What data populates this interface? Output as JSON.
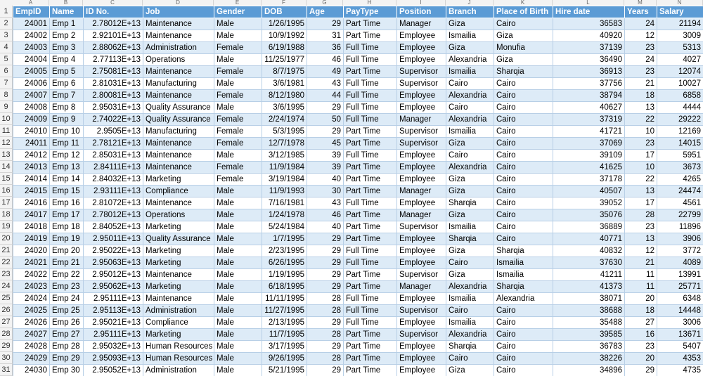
{
  "column_letters": [
    "A",
    "B",
    "C",
    "D",
    "E",
    "F",
    "G",
    "H",
    "I",
    "J",
    "K",
    "L",
    "M",
    "N"
  ],
  "row_numbers": [
    "1",
    "2",
    "3",
    "4",
    "5",
    "6",
    "7",
    "8",
    "9",
    "10",
    "11",
    "12",
    "13",
    "14",
    "15",
    "16",
    "17",
    "18",
    "19",
    "20",
    "21",
    "22",
    "23",
    "24",
    "25",
    "26",
    "27",
    "28",
    "29",
    "30",
    "31"
  ],
  "headers": [
    "EmpID",
    "Name",
    "ID No.",
    "Job",
    "Gender",
    "DOB",
    "Age",
    "PayType",
    "Position",
    "Branch",
    "Place of Birth",
    "Hire date",
    "Years",
    "Salary"
  ],
  "colors": {
    "header_bg": "#5b9bd5",
    "header_text": "#ffffff",
    "band_bg": "#ddebf7",
    "grid": "#b8cfe6"
  },
  "rows": [
    [
      "24001",
      "Emp 1",
      "2.78012E+13",
      "Maintenance",
      "Male",
      "1/26/1995",
      "29",
      "Part Time",
      "Manager",
      "Giza",
      "Cairo",
      "36583",
      "24",
      "21194"
    ],
    [
      "24002",
      "Emp 2",
      "2.92101E+13",
      "Maintenance",
      "Male",
      "10/9/1992",
      "31",
      "Part Time",
      "Employee",
      "Ismailia",
      "Giza",
      "40920",
      "12",
      "3009"
    ],
    [
      "24003",
      "Emp 3",
      "2.88062E+13",
      "Administration",
      "Female",
      "6/19/1988",
      "36",
      "Full Time",
      "Employee",
      "Giza",
      "Monufia",
      "37139",
      "23",
      "5313"
    ],
    [
      "24004",
      "Emp 4",
      "2.77113E+13",
      "Operations",
      "Male",
      "11/25/1977",
      "46",
      "Full Time",
      "Employee",
      "Alexandria",
      "Giza",
      "36490",
      "24",
      "4027"
    ],
    [
      "24005",
      "Emp 5",
      "2.75081E+13",
      "Maintenance",
      "Female",
      "8/7/1975",
      "49",
      "Part Time",
      "Supervisor",
      "Ismailia",
      "Sharqia",
      "36913",
      "23",
      "12074"
    ],
    [
      "24006",
      "Emp 6",
      "2.81031E+13",
      "Manufacturing",
      "Male",
      "3/6/1981",
      "43",
      "Full Time",
      "Supervisor",
      "Cairo",
      "Cairo",
      "37756",
      "21",
      "10027"
    ],
    [
      "24007",
      "Emp 7",
      "2.80081E+13",
      "Maintenance",
      "Female",
      "8/12/1980",
      "44",
      "Full Time",
      "Employee",
      "Alexandria",
      "Cairo",
      "38794",
      "18",
      "6858"
    ],
    [
      "24008",
      "Emp 8",
      "2.95031E+13",
      "Quality Assurance",
      "Male",
      "3/6/1995",
      "29",
      "Full Time",
      "Employee",
      "Cairo",
      "Cairo",
      "40627",
      "13",
      "4444"
    ],
    [
      "24009",
      "Emp 9",
      "2.74022E+13",
      "Quality Assurance",
      "Female",
      "2/24/1974",
      "50",
      "Full Time",
      "Manager",
      "Alexandria",
      "Cairo",
      "37319",
      "22",
      "29222"
    ],
    [
      "24010",
      "Emp 10",
      "2.9505E+13",
      "Manufacturing",
      "Female",
      "5/3/1995",
      "29",
      "Part Time",
      "Supervisor",
      "Ismailia",
      "Cairo",
      "41721",
      "10",
      "12169"
    ],
    [
      "24011",
      "Emp 11",
      "2.78121E+13",
      "Maintenance",
      "Female",
      "12/7/1978",
      "45",
      "Part Time",
      "Supervisor",
      "Giza",
      "Cairo",
      "37069",
      "23",
      "14015"
    ],
    [
      "24012",
      "Emp 12",
      "2.85031E+13",
      "Maintenance",
      "Male",
      "3/12/1985",
      "39",
      "Full Time",
      "Employee",
      "Cairo",
      "Cairo",
      "39109",
      "17",
      "5951"
    ],
    [
      "24013",
      "Emp 13",
      "2.84111E+13",
      "Maintenance",
      "Female",
      "11/9/1984",
      "39",
      "Part Time",
      "Employee",
      "Alexandria",
      "Cairo",
      "41625",
      "10",
      "3673"
    ],
    [
      "24014",
      "Emp 14",
      "2.84032E+13",
      "Marketing",
      "Female",
      "3/19/1984",
      "40",
      "Part Time",
      "Employee",
      "Giza",
      "Cairo",
      "37178",
      "22",
      "4265"
    ],
    [
      "24015",
      "Emp 15",
      "2.93111E+13",
      "Compliance",
      "Male",
      "11/9/1993",
      "30",
      "Part Time",
      "Manager",
      "Giza",
      "Cairo",
      "40507",
      "13",
      "24474"
    ],
    [
      "24016",
      "Emp 16",
      "2.81072E+13",
      "Maintenance",
      "Male",
      "7/16/1981",
      "43",
      "Full Time",
      "Employee",
      "Sharqia",
      "Cairo",
      "39052",
      "17",
      "4561"
    ],
    [
      "24017",
      "Emp 17",
      "2.78012E+13",
      "Operations",
      "Male",
      "1/24/1978",
      "46",
      "Part Time",
      "Manager",
      "Giza",
      "Cairo",
      "35076",
      "28",
      "22799"
    ],
    [
      "24018",
      "Emp 18",
      "2.84052E+13",
      "Marketing",
      "Male",
      "5/24/1984",
      "40",
      "Part Time",
      "Supervisor",
      "Ismailia",
      "Cairo",
      "36889",
      "23",
      "11896"
    ],
    [
      "24019",
      "Emp 19",
      "2.95011E+13",
      "Quality Assurance",
      "Male",
      "1/7/1995",
      "29",
      "Part Time",
      "Employee",
      "Sharqia",
      "Cairo",
      "40771",
      "13",
      "3906"
    ],
    [
      "24020",
      "Emp 20",
      "2.95022E+13",
      "Marketing",
      "Male",
      "2/23/1995",
      "29",
      "Full Time",
      "Employee",
      "Giza",
      "Sharqia",
      "40832",
      "12",
      "3772"
    ],
    [
      "24021",
      "Emp 21",
      "2.95063E+13",
      "Marketing",
      "Male",
      "6/26/1995",
      "29",
      "Full Time",
      "Employee",
      "Cairo",
      "Ismailia",
      "37630",
      "21",
      "4089"
    ],
    [
      "24022",
      "Emp 22",
      "2.95012E+13",
      "Maintenance",
      "Male",
      "1/19/1995",
      "29",
      "Part Time",
      "Supervisor",
      "Giza",
      "Ismailia",
      "41211",
      "11",
      "13991"
    ],
    [
      "24023",
      "Emp 23",
      "2.95062E+13",
      "Marketing",
      "Male",
      "6/18/1995",
      "29",
      "Part Time",
      "Manager",
      "Alexandria",
      "Sharqia",
      "41373",
      "11",
      "25771"
    ],
    [
      "24024",
      "Emp 24",
      "2.95111E+13",
      "Maintenance",
      "Male",
      "11/11/1995",
      "28",
      "Full Time",
      "Employee",
      "Ismailia",
      "Alexandria",
      "38071",
      "20",
      "6348"
    ],
    [
      "24025",
      "Emp 25",
      "2.95113E+13",
      "Administration",
      "Male",
      "11/27/1995",
      "28",
      "Full Time",
      "Supervisor",
      "Cairo",
      "Cairo",
      "38688",
      "18",
      "14448"
    ],
    [
      "24026",
      "Emp 26",
      "2.95021E+13",
      "Compliance",
      "Male",
      "2/13/1995",
      "29",
      "Full Time",
      "Employee",
      "Ismailia",
      "Cairo",
      "35488",
      "27",
      "3006"
    ],
    [
      "24027",
      "Emp 27",
      "2.95111E+13",
      "Marketing",
      "Male",
      "11/7/1995",
      "28",
      "Part Time",
      "Supervisor",
      "Alexandria",
      "Cairo",
      "39585",
      "16",
      "13671"
    ],
    [
      "24028",
      "Emp 28",
      "2.95032E+13",
      "Human Resources",
      "Male",
      "3/17/1995",
      "29",
      "Part Time",
      "Employee",
      "Sharqia",
      "Cairo",
      "36783",
      "23",
      "5407"
    ],
    [
      "24029",
      "Emp 29",
      "2.95093E+13",
      "Human Resources",
      "Male",
      "9/26/1995",
      "28",
      "Part Time",
      "Employee",
      "Cairo",
      "Cairo",
      "38226",
      "20",
      "4353"
    ],
    [
      "24030",
      "Emp 30",
      "2.95052E+13",
      "Administration",
      "Male",
      "5/21/1995",
      "29",
      "Part Time",
      "Employee",
      "Giza",
      "Cairo",
      "34896",
      "29",
      "4735"
    ]
  ]
}
